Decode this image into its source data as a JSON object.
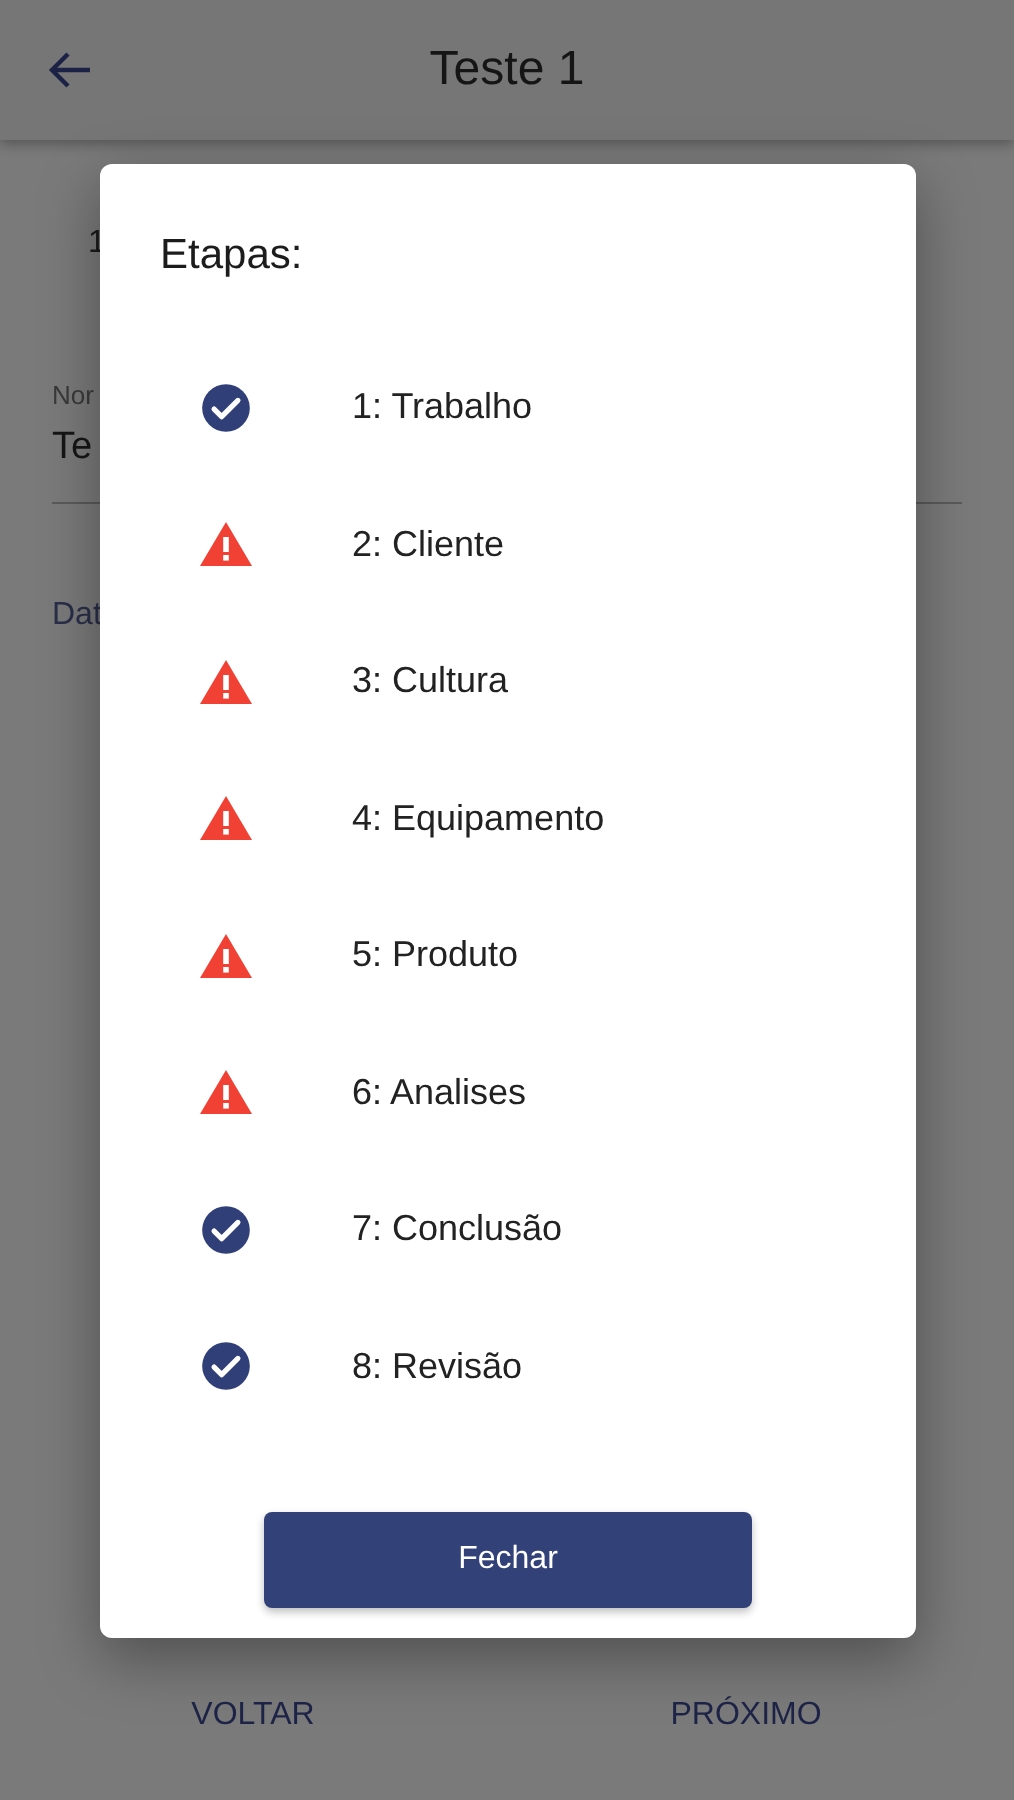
{
  "header": {
    "title": "Teste 1"
  },
  "background": {
    "step_number": "1",
    "field_label": "Nor",
    "field_value": "Te",
    "date_label": "Dat"
  },
  "dialog": {
    "title": "Etapas:",
    "steps": [
      {
        "label": "1: Trabalho",
        "kind": "done"
      },
      {
        "label": "2: Cliente",
        "kind": "warning"
      },
      {
        "label": "3: Cultura",
        "kind": "warning"
      },
      {
        "label": "4: Equipamento",
        "kind": "warning"
      },
      {
        "label": "5: Produto",
        "kind": "warning"
      },
      {
        "label": "6: Analises",
        "kind": "warning"
      },
      {
        "label": "7: Conclusão",
        "kind": "done"
      },
      {
        "label": "8: Revisão",
        "kind": "done"
      }
    ],
    "button": "Fechar"
  },
  "footer": {
    "back": "VOLTAR",
    "next": "PRÓXIMO"
  }
}
